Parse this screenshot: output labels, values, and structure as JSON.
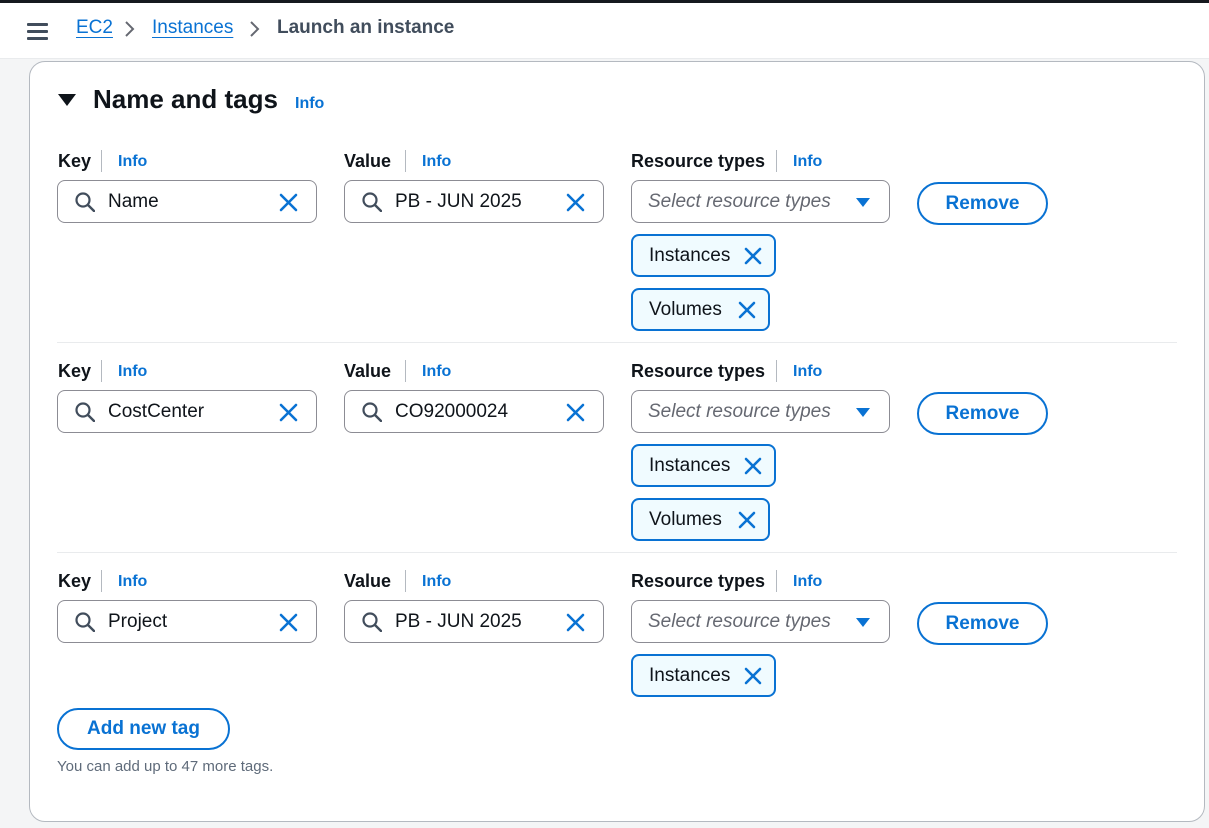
{
  "breadcrumb": {
    "items": [
      "EC2",
      "Instances"
    ],
    "current": "Launch an instance"
  },
  "section": {
    "title": "Name and tags",
    "info": "Info"
  },
  "labels": {
    "key": "Key",
    "value": "Value",
    "resource_types": "Resource types",
    "info": "Info",
    "select_placeholder": "Select resource types",
    "remove": "Remove"
  },
  "tags": [
    {
      "key": "Name",
      "value": "PB - JUN 2025",
      "resource_types": [
        "Instances",
        "Volumes"
      ]
    },
    {
      "key": "CostCenter",
      "value": "CO92000024",
      "resource_types": [
        "Instances",
        "Volumes"
      ]
    },
    {
      "key": "Project",
      "value": "PB - JUN 2025",
      "resource_types": [
        "Instances"
      ]
    }
  ],
  "add_button": "Add new tag",
  "hint": "You can add up to 47 more tags.",
  "icons": {
    "menu": "hamburger-menu-icon",
    "breadcrumb_separator": "chevron-right-icon",
    "collapse": "caret-down-icon",
    "search": "search-icon",
    "clear": "close-icon",
    "dropdown": "caret-down-icon",
    "token_remove": "close-icon"
  },
  "colors": {
    "accent": "#0972d3",
    "text": "#0f141a",
    "border": "#8c8c94",
    "token_bg": "#f0fbff"
  }
}
